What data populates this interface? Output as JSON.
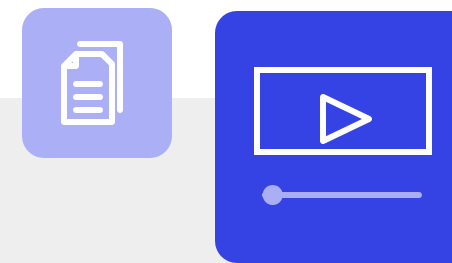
{
  "tiles": [
    {
      "id": "documents",
      "icon": "documents-icon",
      "color": "#abaff6",
      "icon_color": "#ffffff"
    },
    {
      "id": "video",
      "icon": "video-player-icon",
      "color": "#3643e4",
      "icon_color": "#ffffff",
      "accent_color": "#a9aef5",
      "progress": 0.05
    }
  ],
  "background": {
    "top": "#ffffff",
    "band": "#eeeeee"
  }
}
